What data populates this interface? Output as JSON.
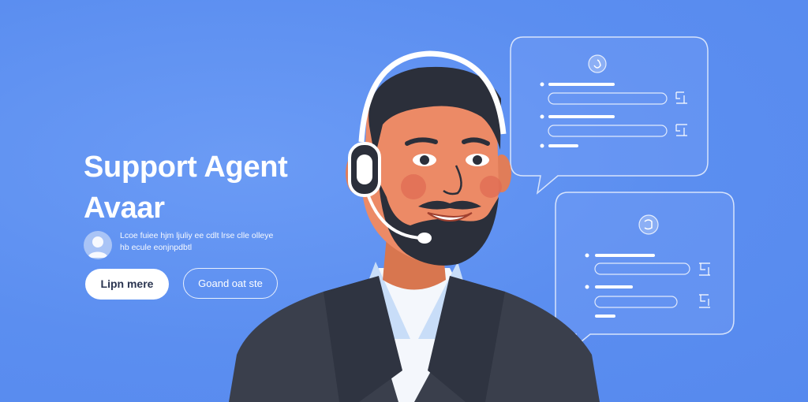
{
  "hero": {
    "title_line1": "Support Agent",
    "title_line2": "Avaar",
    "description_line1": "Lcoe fuiee hjm ljuliy ee cdlt lrse clle olleye",
    "description_line2": "hb ecule eonjnpdbtl"
  },
  "buttons": {
    "primary_label": "Lipn mere",
    "secondary_label": "Goand oat ste"
  },
  "colors": {
    "background": "#5b8ef0",
    "text": "#ffffff",
    "suit": "#3a3f4c",
    "skin": "#ec8a66",
    "shirt": "#c8ddf8"
  },
  "icons": {
    "user_avatar": "user-avatar-icon",
    "chat_bubble_top": "chat-bubble-icon",
    "chat_bubble_bottom": "chat-bubble-icon",
    "agent_illustration": "support-agent-headset-illustration"
  }
}
